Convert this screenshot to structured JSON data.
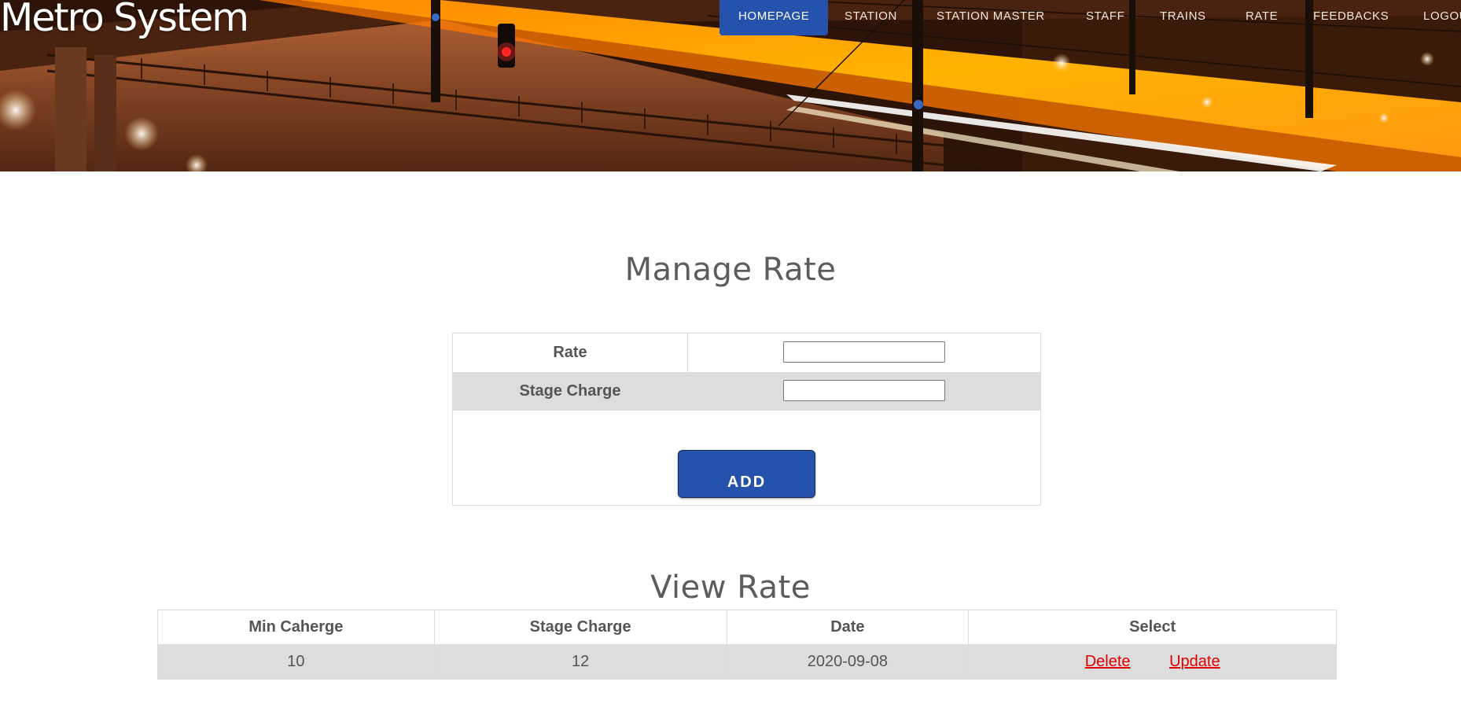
{
  "header": {
    "site_title": "Metro System",
    "nav": [
      {
        "label": "HOMEPAGE",
        "active": true
      },
      {
        "label": "STATION"
      },
      {
        "label": "STATION MASTER"
      },
      {
        "label": "STAFF"
      },
      {
        "label": "TRAINS"
      },
      {
        "label": "RATE"
      },
      {
        "label": "FEEDBACKS"
      },
      {
        "label": "LOGOUT"
      }
    ]
  },
  "manage": {
    "title": "Manage Rate",
    "fields": [
      {
        "label": "Rate",
        "value": ""
      },
      {
        "label": "Stage Charge",
        "value": ""
      }
    ],
    "add_label": "ADD"
  },
  "view": {
    "title": "View Rate",
    "columns": [
      "Min Caherge",
      "Stage Charge",
      "Date",
      "Select"
    ],
    "rows": [
      {
        "min_charge": "10",
        "stage_charge": "12",
        "date": "2020-09-08",
        "delete_label": "Delete",
        "update_label": "Update"
      }
    ]
  },
  "colors": {
    "accent": "#2452ad",
    "link": "#e00000",
    "row_alt": "#dddddd"
  }
}
